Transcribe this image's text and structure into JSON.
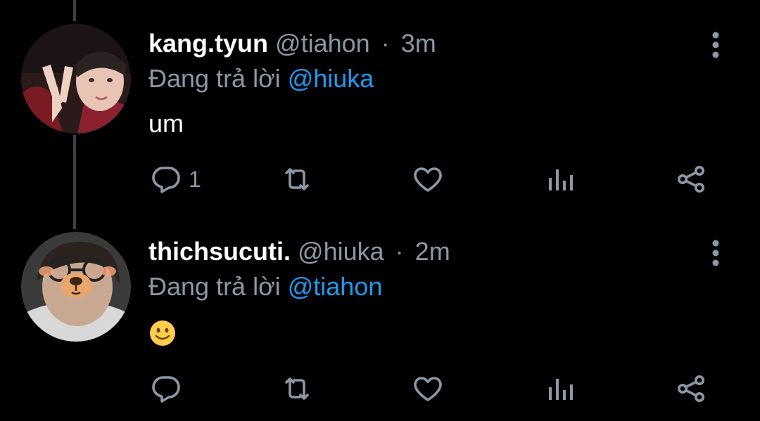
{
  "tweets": [
    {
      "display_name": "kang.tyun",
      "handle": "@tiahon",
      "separator": "·",
      "time": "3m",
      "reply_prefix": "Đang trả lời",
      "reply_mention": "@hiuka",
      "body": "um",
      "reply_count": "1",
      "avatar": "selfie-peace-sign"
    },
    {
      "display_name": "thichsucuti.",
      "handle": "@hiuka",
      "separator": "·",
      "time": "2m",
      "reply_prefix": "Đang trả lời",
      "reply_mention": "@tiahon",
      "body_emoji": "slightly-smiling-face",
      "reply_count": "",
      "avatar": "bear-filter-selfie"
    }
  ],
  "icons": {
    "reply": "reply-icon",
    "retweet": "retweet-icon",
    "like": "heart-icon",
    "views": "analytics-icon",
    "share": "share-icon",
    "more": "more-vertical-icon"
  },
  "colors": {
    "background": "#000000",
    "text": "#ffffff",
    "muted": "#8b98a5",
    "link": "#1d9bf0",
    "thread_line": "#3d4144"
  }
}
